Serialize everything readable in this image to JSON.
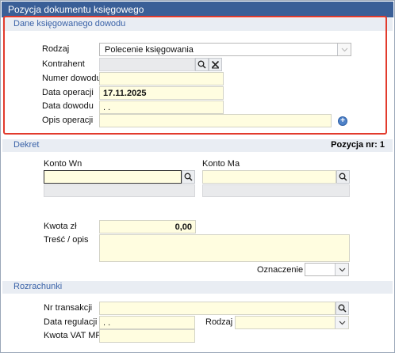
{
  "window": {
    "title": "Pozycja dokumentu księgowego"
  },
  "sections": {
    "dane": "Dane księgowanego dowodu",
    "dekret": "Dekret",
    "pozycja": "Pozycja nr: 1",
    "rozrachunki": "Rozrachunki"
  },
  "dane": {
    "rodzaj_label": "Rodzaj",
    "rodzaj_value": "Polecenie księgowania",
    "kontrahent_label": "Kontrahent",
    "kontrahent_value": "",
    "numer_label": "Numer dowodu",
    "numer_value": "",
    "data_oper_label": "Data operacji",
    "data_oper_value": "17.11.2025",
    "data_dow_label": "Data dowodu",
    "data_dow_value": ". .",
    "opis_label": "Opis operacji",
    "opis_value": ""
  },
  "dekret": {
    "konto_wn_label": "Konto Wn",
    "konto_ma_label": "Konto Ma",
    "kwota_label": "Kwota zł",
    "kwota_value": "0,00",
    "tresc_label": "Treść /  opis",
    "oznaczenie_label": "Oznaczenie"
  },
  "rozrachunki": {
    "nr_transakcji_label": "Nr transakcji",
    "data_regulacji_label": "Data regulacji",
    "data_regulacji_value": ". .",
    "rodzaj_label": "Rodzaj",
    "kwota_vat_label": "Kwota VAT MPP"
  },
  "icons": [
    "search-icon",
    "clear-icon",
    "chevron-down-icon",
    "plus-circle-icon"
  ]
}
